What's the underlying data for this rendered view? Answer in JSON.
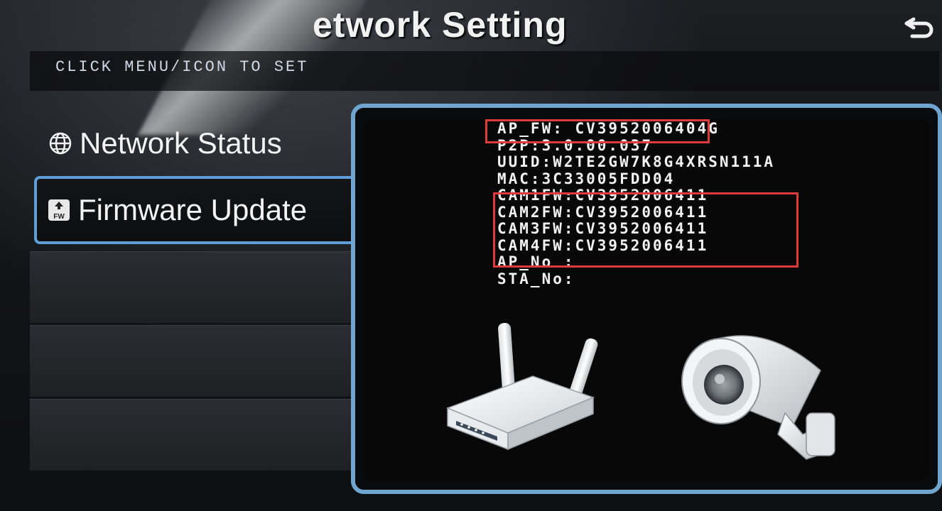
{
  "screen": {
    "title": "etwork Setting",
    "hint": "CLICK MENU/ICON TO SET"
  },
  "sidebar": {
    "items": [
      {
        "label": "Network Status",
        "icon": "globe-icon",
        "selected": false
      },
      {
        "label": "Firmware Update",
        "icon": "firmware-icon",
        "selected": true
      }
    ]
  },
  "info": {
    "ap_fw": "AP_FW: CV3952006404G",
    "p2p": "P2P:3.0.00.037",
    "uuid": "UUID:W2TE2GW7K8G4XRSN111A",
    "mac": "MAC:3C33005FDD04",
    "cam1_fw": "CAM1FW:CV3952006411",
    "cam2_fw": "CAM2FW:CV3952006411",
    "cam3_fw": "CAM3FW:CV3952006411",
    "cam4_fw": "CAM4FW:CV3952006411",
    "ap_no": "AP_No  :",
    "sta_no": "STA_No:"
  },
  "colors": {
    "accent_border": "#5e9fd8",
    "highlight_box": "#e03b3b",
    "text": "#f2f2f2"
  },
  "icons": {
    "back": "back-arrow-icon",
    "router": "wifi-router-icon",
    "camera": "security-camera-icon"
  }
}
